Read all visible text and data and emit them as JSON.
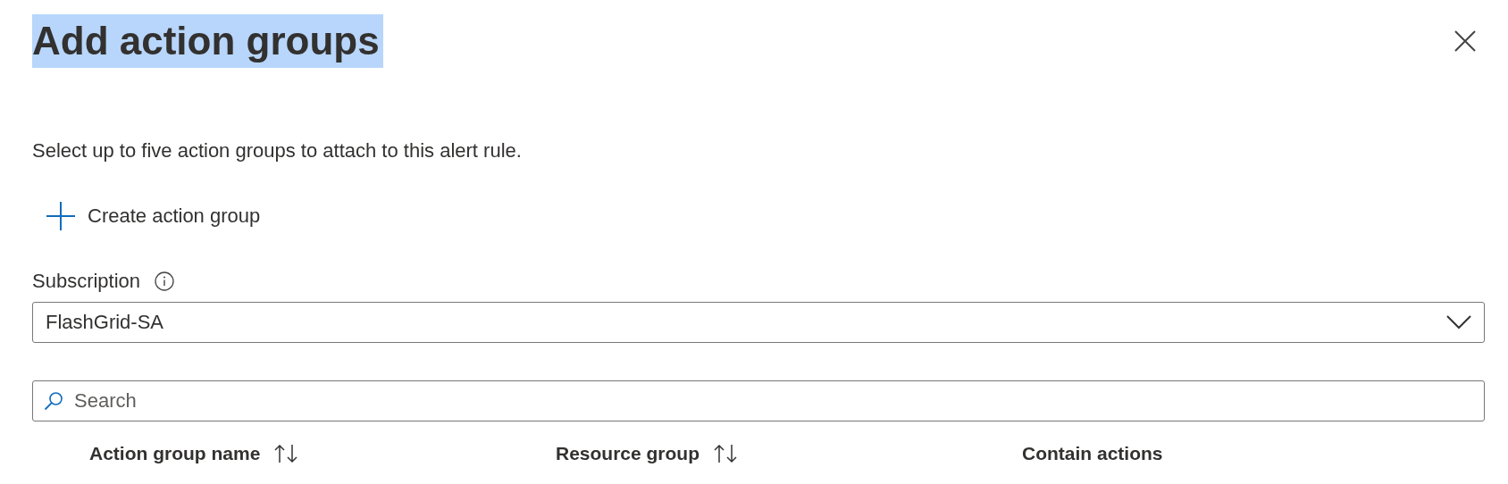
{
  "panel": {
    "title": "Add action groups",
    "description": "Select up to five action groups to attach to this alert rule."
  },
  "create_button": {
    "label": "Create action group"
  },
  "subscription": {
    "label": "Subscription",
    "value": "FlashGrid-SA"
  },
  "search": {
    "placeholder": "Search"
  },
  "table": {
    "columns": [
      {
        "label": "Action group name",
        "sortable": true
      },
      {
        "label": "Resource group",
        "sortable": true
      },
      {
        "label": "Contain actions",
        "sortable": false
      }
    ]
  }
}
